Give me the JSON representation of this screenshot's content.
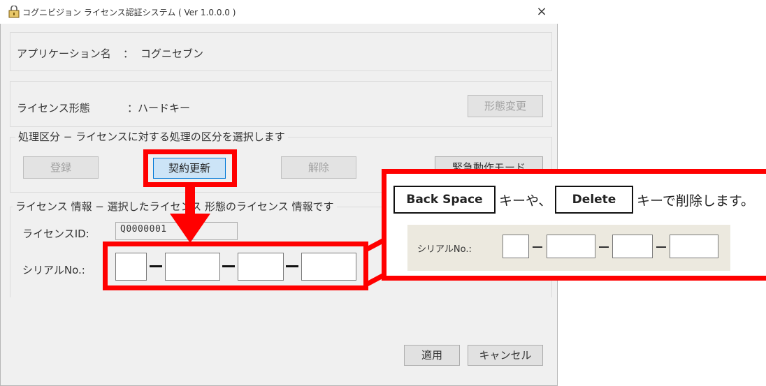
{
  "window": {
    "title": "コグニビジョン ライセンス認証システム ( Ver 1.0.0.0 )",
    "close": "×"
  },
  "app": {
    "label": "アプリケーション名",
    "sep": "：",
    "value": "コグニセブン"
  },
  "license_type": {
    "label": "ライセンス形態",
    "value": "：ハードキー",
    "change_button": "形態変更"
  },
  "process": {
    "legend": "処理区分 − ライセンスに対する処理の区分を選択します",
    "buttons": {
      "register": "登録",
      "renew": "契約更新",
      "release": "解除",
      "emergency": "緊急動作モード"
    }
  },
  "license_info": {
    "legend": "ライセンス 情報 − 選択したライセンス 形態のライセンス 情報です",
    "id_label": "ライセンスID:",
    "id_value": "Q0000001",
    "serial_label": "シリアルNo.:"
  },
  "footer": {
    "apply": "適用",
    "cancel": "キャンセル"
  },
  "callout": {
    "key1": "Back Space",
    "text1": "キーや、",
    "key2": "Delete",
    "text2": "キーで削除します。",
    "serial_label": "シリアルNo.:"
  },
  "colors": {
    "highlight": "#ff0000",
    "selected_button": "#cce4f7",
    "callout_inner_bg": "#ece9df"
  }
}
